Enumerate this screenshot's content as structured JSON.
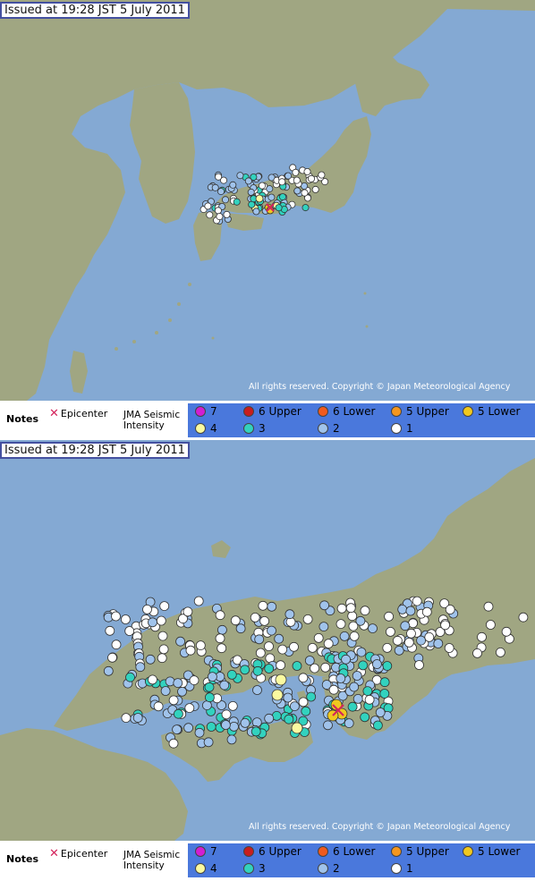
{
  "maps": [
    {
      "issued": "Issued at 19:28 JST  5 July 2011",
      "copyright": "All rights reserved. Copyright © Japan Meteorological Agency"
    },
    {
      "issued": "Issued at 19:28 JST  5 July 2011",
      "copyright": "All rights reserved. Copyright © Japan Meteorological Agency"
    }
  ],
  "legend": {
    "notes": "Notes",
    "epicenter": "Epicenter",
    "jma_line1": "JMA Seismic",
    "jma_line2": "Intensity",
    "levels": [
      {
        "label": "7",
        "color": "#d21ed2"
      },
      {
        "label": "6 Upper",
        "color": "#c81e1e"
      },
      {
        "label": "6 Lower",
        "color": "#f05a1e"
      },
      {
        "label": "5 Upper",
        "color": "#f5961e"
      },
      {
        "label": "5 Lower",
        "color": "#f0c81e"
      },
      {
        "label": "4",
        "color": "#fafaa0"
      },
      {
        "label": "3",
        "color": "#32d2be"
      },
      {
        "label": "2",
        "color": "#a0c3eb"
      },
      {
        "label": "1",
        "color": "#ffffff"
      }
    ]
  },
  "colors": {
    "sea": "#84a9d3",
    "land": "#a0a682",
    "frame": "#4450a0",
    "legend_bar": "#4a78dc"
  },
  "icons": [
    "epicenter-x-icon",
    "intensity-dot-icon"
  ]
}
